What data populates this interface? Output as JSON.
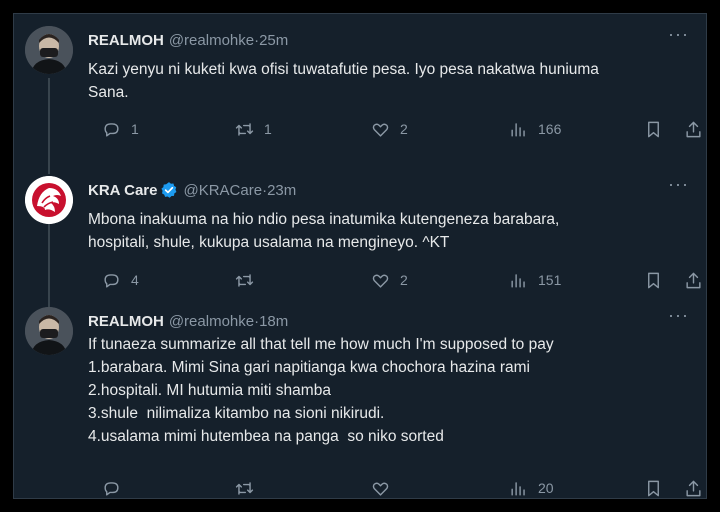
{
  "tweets": [
    {
      "name": "REALMOH",
      "handle": "@realmohke",
      "time": "25m",
      "verified": false,
      "lines": [
        "Kazi yenyu ni kuketi kwa ofisi tuwatafutie pesa. Iyo pesa nakatwa huniuma",
        "Sana."
      ],
      "replies": "1",
      "retweets": "1",
      "likes": "2",
      "views": "166"
    },
    {
      "name": "KRA Care",
      "handle": "@KRACare",
      "time": "23m",
      "verified": true,
      "lines": [
        "Mbona inakuuma na hio ndio pesa inatumika kutengeneza barabara,",
        "hospitali, shule, kukupa usalama na mengineyo. ^KT"
      ],
      "replies": "4",
      "retweets": "",
      "likes": "2",
      "views": "151"
    },
    {
      "name": "REALMOH",
      "handle": "@realmohke",
      "time": "18m",
      "verified": false,
      "lines": [
        "If tunaeza summarize all that tell me how much I'm supposed to pay",
        "1.barabara. Mimi Sina gari napitianga kwa chochora hazina rami",
        "2.hospitali. MI hutumia miti shamba",
        "3.shule  nilimaliza kitambo na sioni nikirudi.",
        "4.usalama mimi hutembea na panga  so niko sorted"
      ],
      "replies": "",
      "retweets": "",
      "likes": "",
      "views": "20"
    }
  ],
  "separator": " · ",
  "more_glyph": "···",
  "colors": {
    "background": "#15202b",
    "text": "#e7e9ea",
    "muted": "#8b98a5",
    "verified": "#1d9bf0"
  }
}
